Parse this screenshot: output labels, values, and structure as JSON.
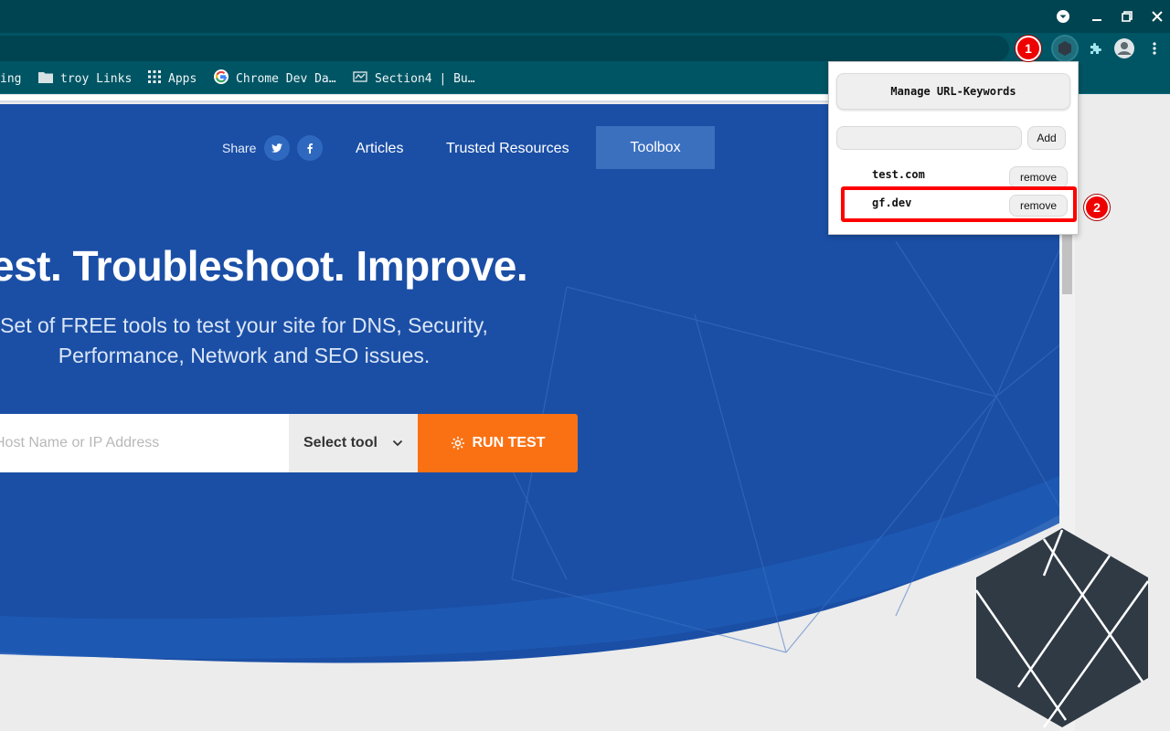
{
  "window": {
    "controls": [
      "minimize",
      "maximize",
      "close"
    ]
  },
  "bookmarks": [
    {
      "label": "ing",
      "icon": "none"
    },
    {
      "label": "troy Links",
      "icon": "folder-icon"
    },
    {
      "label": "Apps",
      "icon": "apps-grid-icon"
    },
    {
      "label": "Chrome Dev Da…",
      "icon": "google-icon"
    },
    {
      "label": "Section4 | Bu…",
      "icon": "section4-icon"
    }
  ],
  "nav": {
    "share_label": "Share",
    "twitter": "twitter-icon",
    "facebook": "facebook-icon",
    "articles": "Articles",
    "trusted_resources": "Trusted Resources",
    "toolbox": "Toolbox"
  },
  "hero": {
    "headline": "est. Troubleshoot. Improve.",
    "subline_1": "Set of FREE tools to test your site for DNS, Security,",
    "subline_2": "Performance, Network and SEO issues.",
    "search_placeholder": "Host Name or IP Address",
    "select_tool": "Select tool",
    "run_test": "RUN TEST"
  },
  "popup": {
    "manage_label": "Manage URL-Keywords",
    "input_value": "",
    "add_label": "Add",
    "keywords": [
      {
        "text": "test.com",
        "remove_label": "remove"
      },
      {
        "text": "gf.dev",
        "remove_label": "remove"
      }
    ]
  },
  "annotations": {
    "marker_1": "1",
    "marker_2": "2"
  },
  "colors": {
    "titlebar": "#004451",
    "toolbar": "#005564",
    "hero_blue": "#1b4fa6",
    "run_test_orange": "#fa7114",
    "highlight_red": "#ff0000"
  }
}
